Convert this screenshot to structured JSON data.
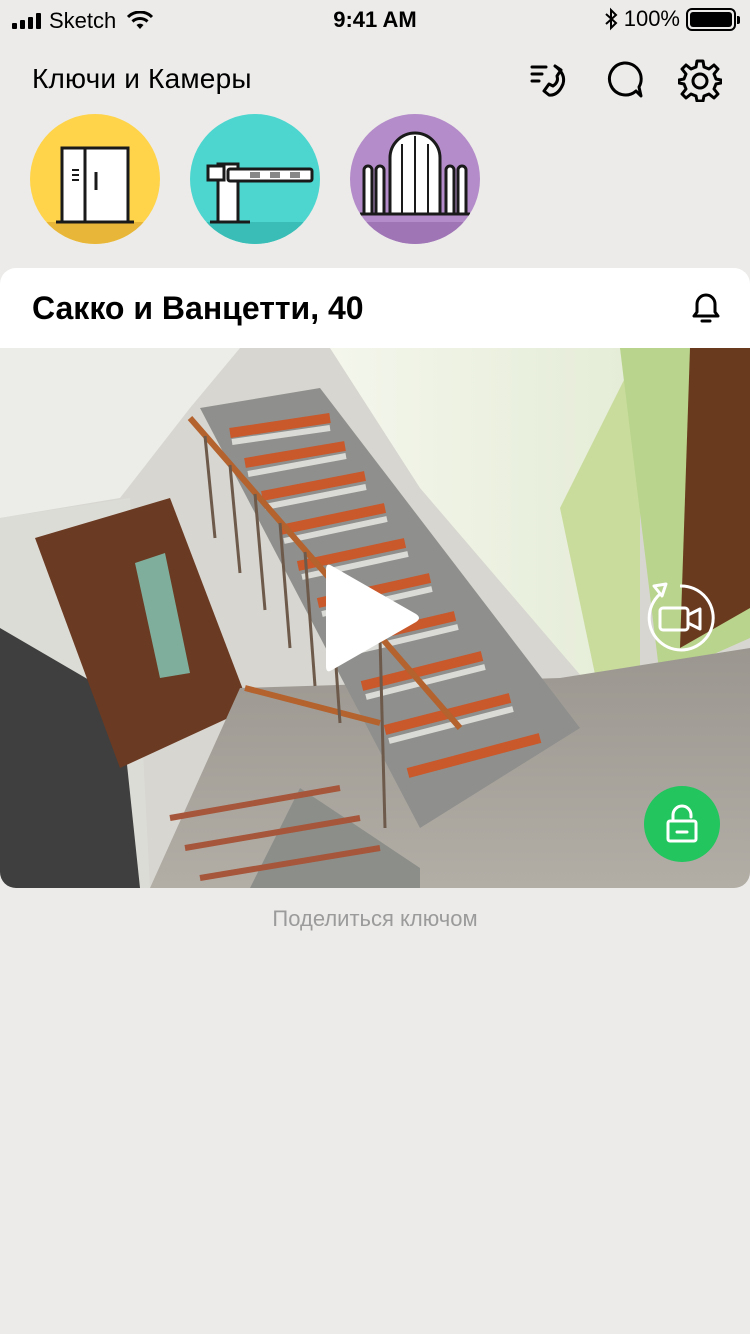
{
  "status_bar": {
    "carrier": "Sketch",
    "time": "9:41 AM",
    "battery": "100%",
    "icons": [
      "signal-icon",
      "wifi-icon",
      "bluetooth-icon",
      "battery-icon"
    ]
  },
  "header": {
    "title": "Ключи и Камеры",
    "actions": [
      "call-log-icon",
      "chat-icon",
      "gear-icon"
    ]
  },
  "shortcuts": [
    {
      "icon": "door-icon",
      "color": "#FFD44A"
    },
    {
      "icon": "barrier-icon",
      "color": "#4CD6CF"
    },
    {
      "icon": "gate-icon",
      "color": "#B48CC9"
    }
  ],
  "camera_card": {
    "title": "Сакко и Ванцетти, 40",
    "icons": [
      "bell-icon",
      "play-icon",
      "switch-camera-icon",
      "unlock-icon"
    ],
    "accent": "#22C55E"
  },
  "share_link": "Поделиться ключом"
}
